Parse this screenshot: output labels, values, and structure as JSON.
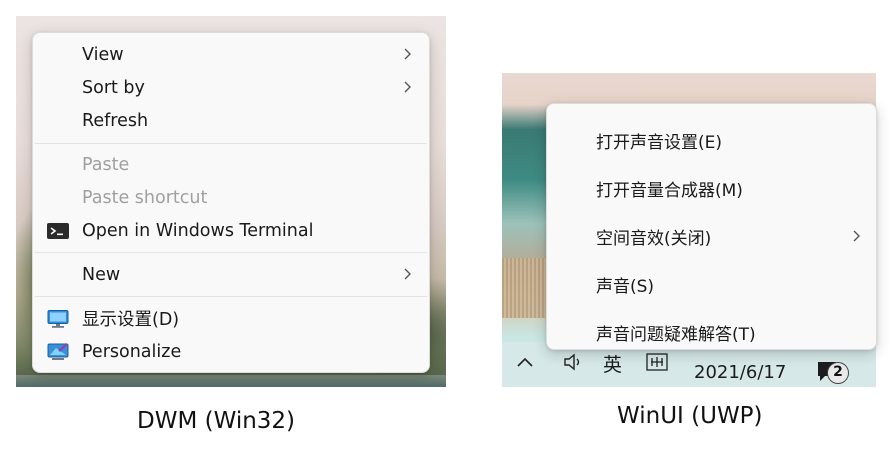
{
  "dwm": {
    "caption": "DWM (Win32)",
    "items": [
      {
        "label": "View"
      },
      {
        "label": "Sort by"
      },
      {
        "label": "Refresh"
      },
      {
        "label": "Paste"
      },
      {
        "label": "Paste shortcut"
      },
      {
        "label": "Open in Windows Terminal",
        "icon": "terminal-icon"
      },
      {
        "label": "New"
      },
      {
        "label": "显示设置(D)",
        "icon": "display-icon"
      },
      {
        "label": "Personalize",
        "icon": "personalize-icon"
      }
    ]
  },
  "winui": {
    "caption": "WinUI (UWP)",
    "items": [
      {
        "label": "打开声音设置(E)"
      },
      {
        "label": "打开音量合成器(M)"
      },
      {
        "label": "空间音效(关闭)"
      },
      {
        "label": "声音(S)"
      },
      {
        "label": "声音问题疑难解答(T)"
      }
    ],
    "taskbar": {
      "ime_label": "英",
      "date": "2021/6/17",
      "notification_count": "2"
    }
  },
  "colors": {
    "menu_bg": "#f9f9f9",
    "disabled_text": "#a0a0a0",
    "text": "#1a1a1a"
  }
}
